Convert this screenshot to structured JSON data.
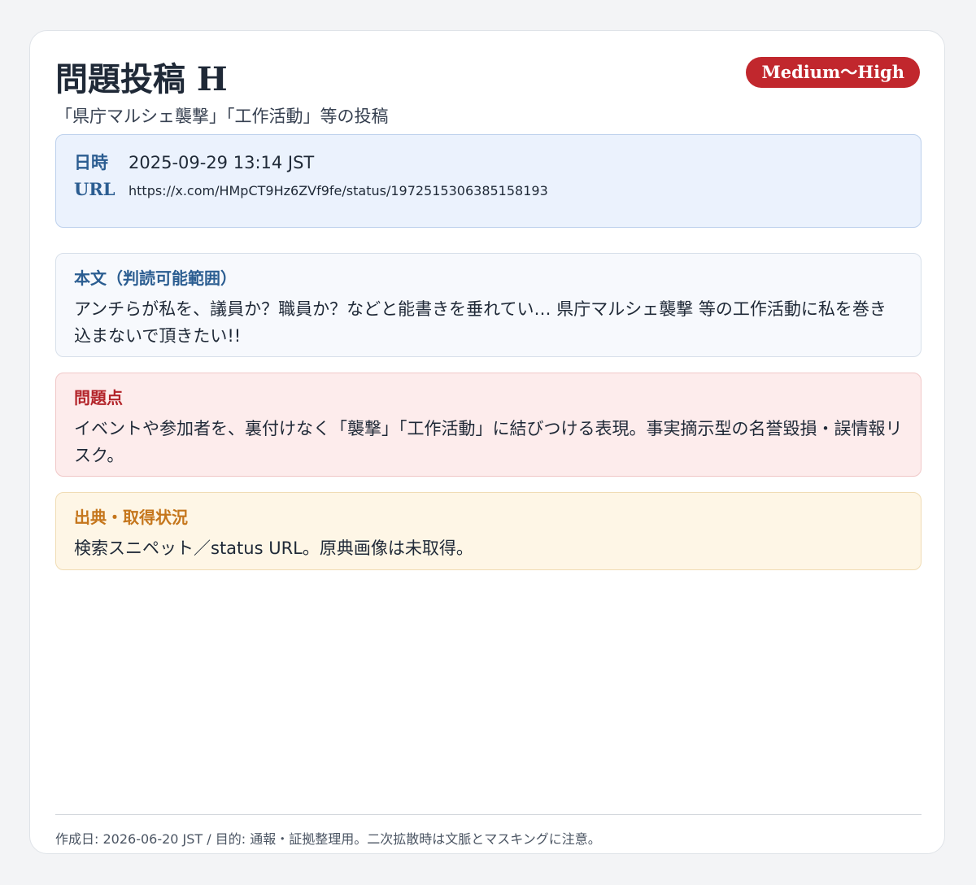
{
  "header": {
    "title": "問題投稿 H",
    "subtitle": "「県庁マルシェ襲撃」「工作活動」等の投稿",
    "severity_badge": "Medium〜High"
  },
  "meta": {
    "date_label": "日時",
    "date_value": "2025-09-29 13:14 JST",
    "url_label": "URL",
    "url_value": "https://x.com/HMpCT9Hz6ZVf9fe/status/1972515306385158193"
  },
  "sections": {
    "body": {
      "label": "本文（判読可能範囲）",
      "text": "アンチらが私を、議員か？職員か？などと能書きを垂れてい… 県庁マルシェ襲撃 等の工作活動に私を巻き込まないで頂きたい!!"
    },
    "issue": {
      "label": "問題点",
      "text": "イベントや参加者を、裏付けなく「襲撃」「工作活動」に結びつける表現。事実摘示型の名誉毀損・誤情報リスク。"
    },
    "source": {
      "label": "出典・取得状況",
      "text": "検索スニペット／status URL。原典画像は未取得。"
    }
  },
  "footer": {
    "text": "作成日: 2026-06-20 JST / 目的: 通報・証拠整理用。二次拡散時は文脈とマスキングに注意。"
  },
  "colors": {
    "page_background": "#f3f4f6",
    "badge": "#c1272d",
    "meta_box": "#ebf2fd",
    "body_box": "#f7f9fd",
    "issue_box": "#fdecec",
    "source_box": "#fef6e6",
    "label_blue": "#2b5d91",
    "label_red": "#b3242a",
    "label_orange": "#c5761c"
  }
}
